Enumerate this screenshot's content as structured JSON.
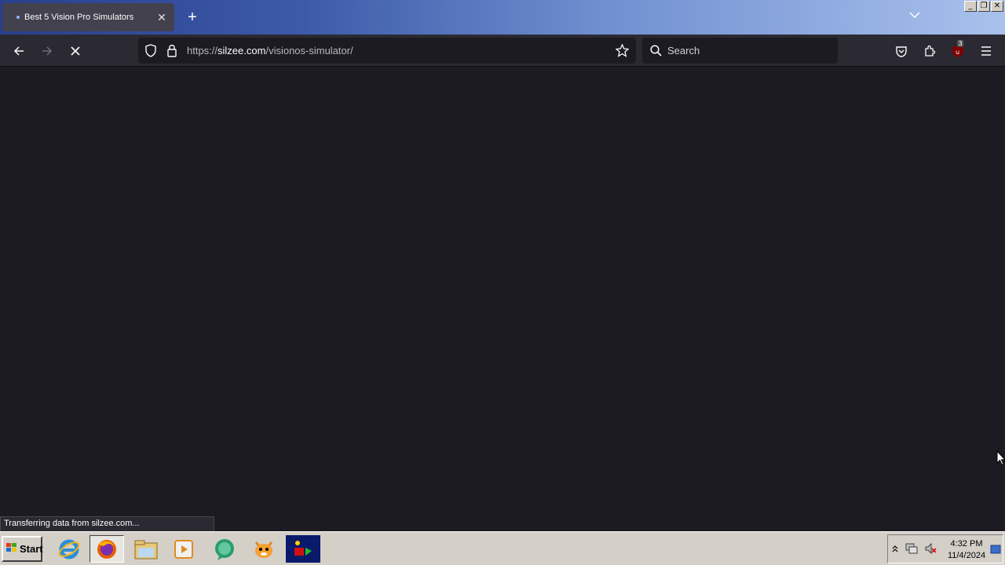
{
  "browser": {
    "tab": {
      "title": "Best 5 Vision Pro Simulators",
      "close": "✕"
    },
    "new_tab": "+",
    "url": {
      "scheme": "https://",
      "host": "silzee.com",
      "path": "/visionos-simulator/"
    },
    "search_placeholder": "Search",
    "extension_badge": "3",
    "status_text": "Transferring data from silzee.com..."
  },
  "taskbar": {
    "start_label": "Start",
    "clock_time": "4:32 PM",
    "clock_date": "11/4/2024"
  },
  "colors": {
    "content_bg": "#1c1b22",
    "toolbar_bg": "#2b2a33",
    "taskbar_bg": "#d4d0c8"
  }
}
